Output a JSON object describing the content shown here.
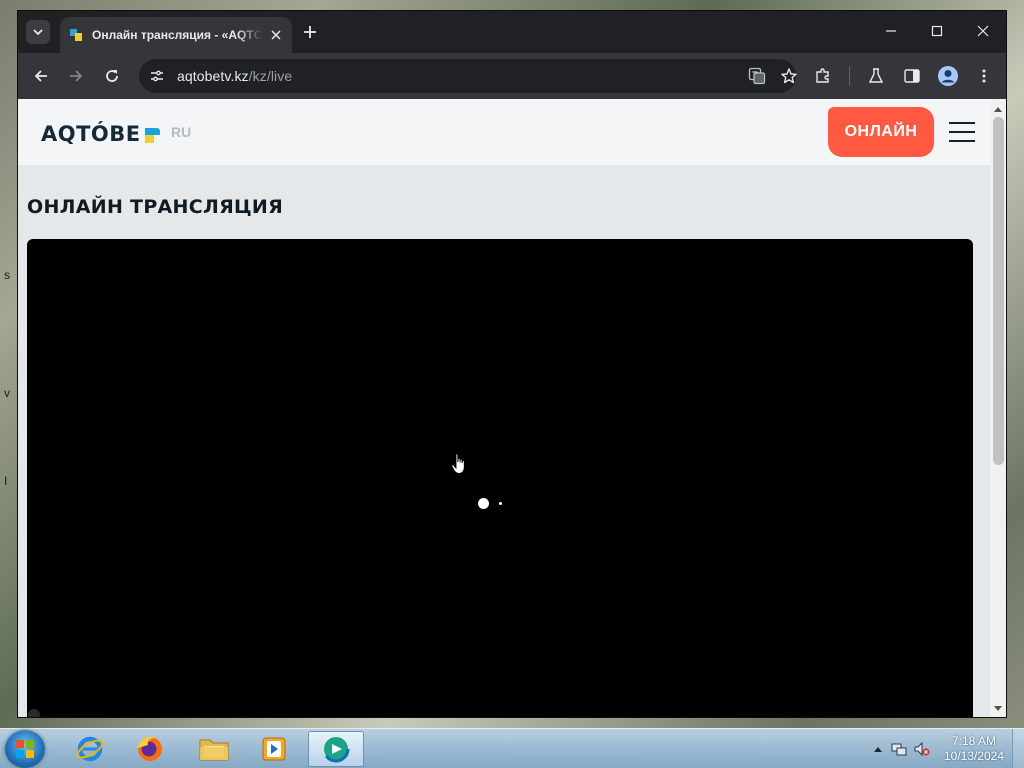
{
  "desktop": {
    "edge_glyphs": [
      "s",
      "v",
      "I"
    ]
  },
  "browser": {
    "tab": {
      "title": "Онлайн трансляция - «AQTÓBE»"
    },
    "url": {
      "host": "aqtobetv.kz",
      "path": "/kz/live"
    }
  },
  "site": {
    "logo": "AQTÓBE",
    "lang": "RU",
    "online_button": "ОНЛАЙН",
    "page_title": "ОНЛАЙН ТРАНСЛЯЦИЯ",
    "player": {
      "state": "loading"
    }
  },
  "taskbar": {
    "apps": [
      {
        "name": "Internet Explorer",
        "icon": "ie-icon"
      },
      {
        "name": "Firefox",
        "icon": "firefox-icon"
      },
      {
        "name": "Windows Explorer",
        "icon": "folder-icon"
      },
      {
        "name": "Windows Media Player",
        "icon": "media-player-icon"
      },
      {
        "name": "Edge",
        "icon": "edge-icon",
        "active": true
      }
    ],
    "clock": {
      "time": "7:18 AM",
      "date": "10/13/2024"
    }
  },
  "colors": {
    "accent_online": "#ff5a41",
    "logo_blue": "#18a5de",
    "logo_yellow": "#f0cf36",
    "browser_dark": "#202124"
  }
}
